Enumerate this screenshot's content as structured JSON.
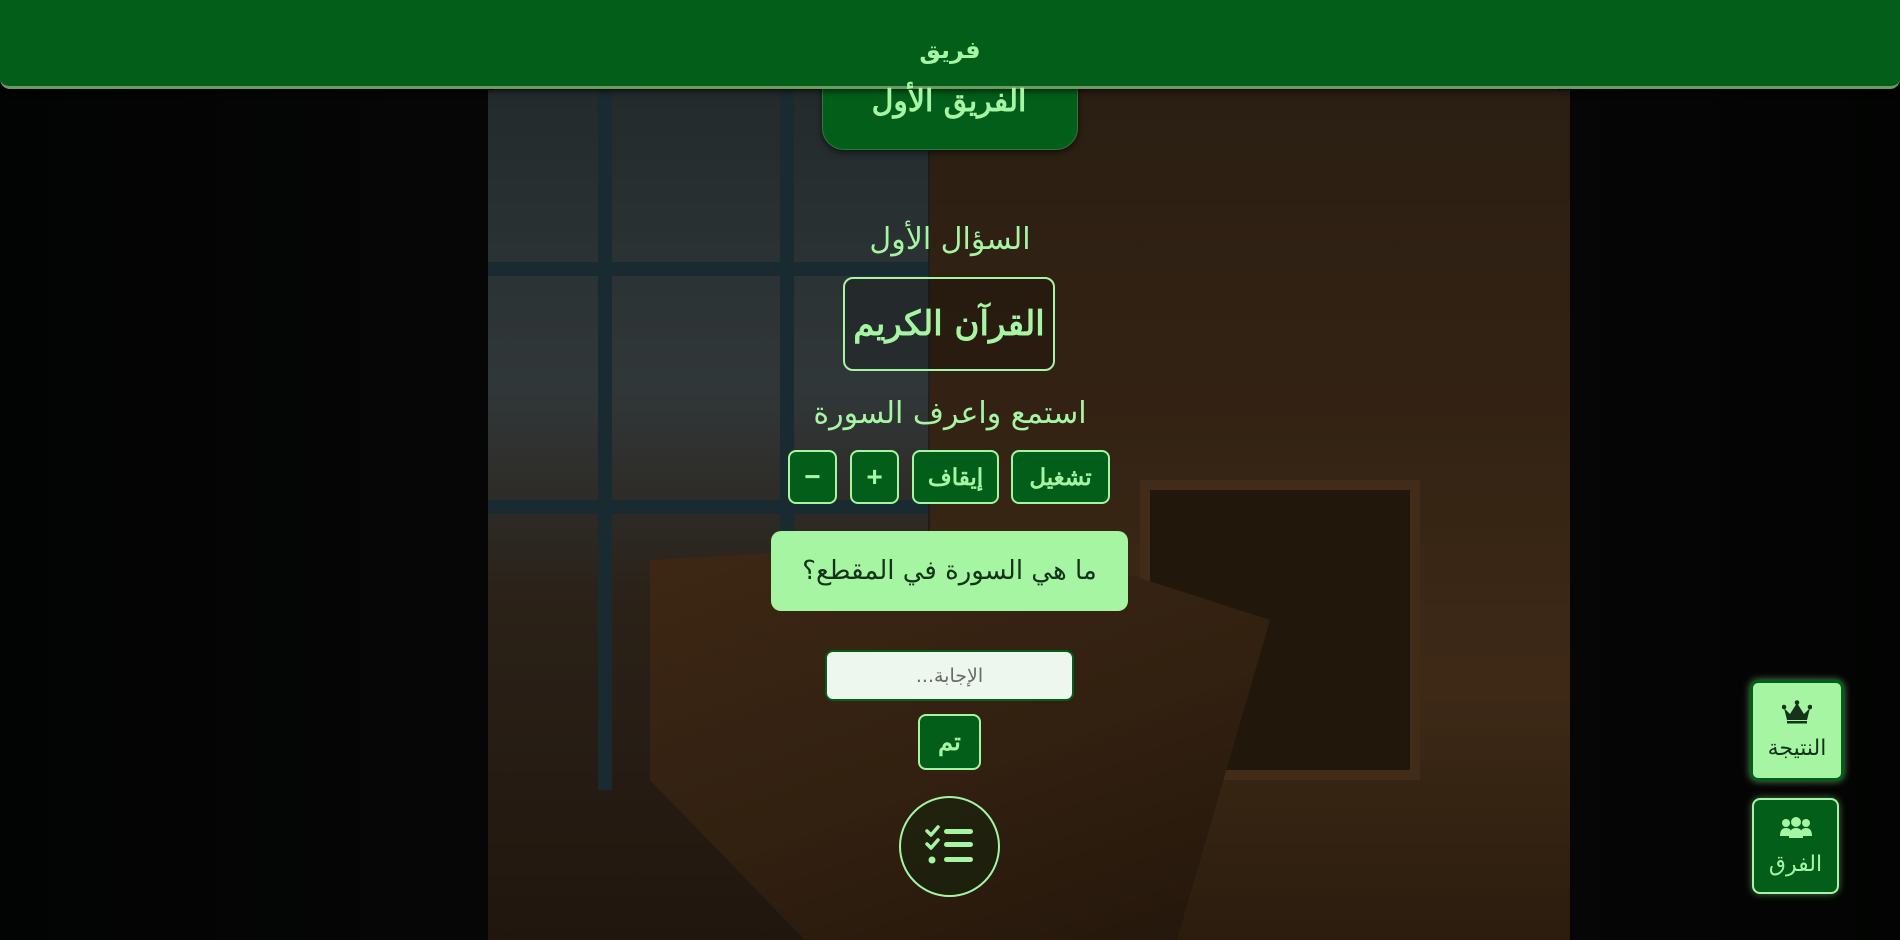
{
  "header": {
    "caption": "فريق",
    "team_name": "الفريق الأول"
  },
  "main": {
    "question_number": "السؤال الأول",
    "category": "القرآن الكريم",
    "instruction": "استمع واعرف السورة",
    "controls": {
      "play_label": "تشغيل",
      "stop_label": "إيقاف",
      "increase_label": "+",
      "decrease_label": "−"
    },
    "question": "ما هي السورة في المقطع؟",
    "answer": {
      "value": "",
      "placeholder": "الإجابة..."
    },
    "done_label": "تم",
    "list_icon": "checklist-icon"
  },
  "floating": {
    "score_label": "النتيجة",
    "score_icon": "crown-icon",
    "teams_label": "الفرق",
    "teams_icon": "users-icon"
  },
  "colors": {
    "primary": "#035e1a",
    "accent": "#a6f5a3",
    "text_dark": "#14331a"
  }
}
